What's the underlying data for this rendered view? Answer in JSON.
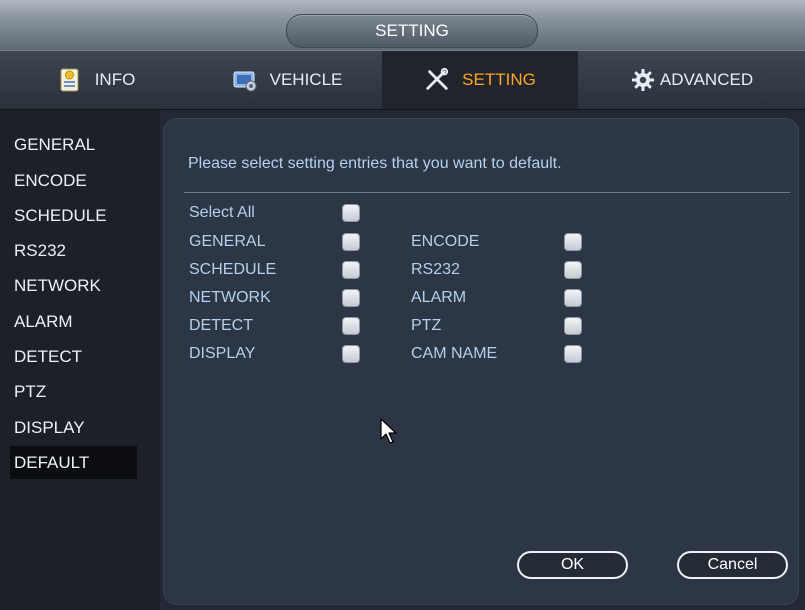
{
  "window": {
    "title": "SETTING"
  },
  "tabs": [
    {
      "label": "INFO",
      "icon": "info-icon"
    },
    {
      "label": "VEHICLE",
      "icon": "vehicle-icon"
    },
    {
      "label": "SETTING",
      "icon": "tools-icon",
      "active": true
    },
    {
      "label": "ADVANCED",
      "icon": "gear-icon"
    }
  ],
  "sidebar": {
    "items": [
      {
        "label": "GENERAL"
      },
      {
        "label": "ENCODE"
      },
      {
        "label": "SCHEDULE"
      },
      {
        "label": "RS232"
      },
      {
        "label": "NETWORK"
      },
      {
        "label": "ALARM"
      },
      {
        "label": "DETECT"
      },
      {
        "label": "PTZ"
      },
      {
        "label": "DISPLAY"
      },
      {
        "label": "DEFAULT",
        "active": true
      }
    ]
  },
  "main": {
    "prompt": "Please select setting entries that you want to default.",
    "select_all": {
      "label": "Select All",
      "checked": false
    },
    "options_left": [
      {
        "label": "GENERAL",
        "checked": false
      },
      {
        "label": "SCHEDULE",
        "checked": false
      },
      {
        "label": "NETWORK",
        "checked": false
      },
      {
        "label": "DETECT",
        "checked": false
      },
      {
        "label": "DISPLAY",
        "checked": false
      }
    ],
    "options_right": [
      {
        "label": "ENCODE",
        "checked": false
      },
      {
        "label": "RS232",
        "checked": false
      },
      {
        "label": "ALARM",
        "checked": false
      },
      {
        "label": "PTZ",
        "checked": false
      },
      {
        "label": "CAM NAME",
        "checked": false
      }
    ],
    "ok_label": "OK",
    "cancel_label": "Cancel"
  },
  "colors": {
    "active_tab_text": "#ffa41e",
    "option_text": "#b4d0ee"
  }
}
